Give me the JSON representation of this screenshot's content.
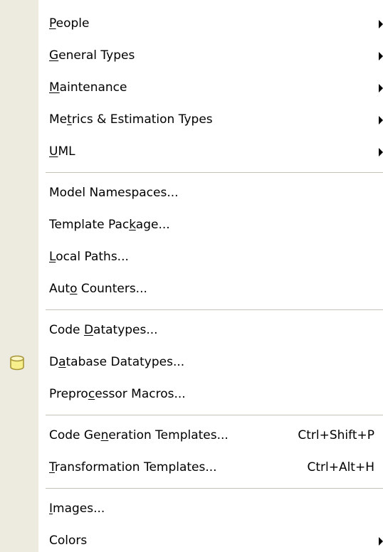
{
  "menu": {
    "people": {
      "label": "People",
      "mnemonic": "P"
    },
    "general_types": {
      "label": "General Types",
      "mnemonic": "G"
    },
    "maintenance": {
      "label": "Maintenance",
      "mnemonic": "M"
    },
    "metrics": {
      "label": "Metrics & Estimation Types",
      "mnemonic": "t"
    },
    "uml": {
      "label": "UML",
      "mnemonic": "U"
    },
    "model_namespaces": {
      "label": "Model Namespaces..."
    },
    "template_package": {
      "label": "Template Package...",
      "mnemonic": "k"
    },
    "local_paths": {
      "label": "Local Paths...",
      "mnemonic": "L"
    },
    "auto_counters": {
      "label": "Auto Counters...",
      "mnemonic": "o"
    },
    "code_datatypes": {
      "label": "Code Datatypes...",
      "mnemonic": "D"
    },
    "database_datatypes": {
      "label": "Database Datatypes...",
      "mnemonic": "a",
      "icon": "database-icon"
    },
    "preprocessor_macros": {
      "label": "Preprocessor Macros...",
      "mnemonic": "c"
    },
    "code_generation_templates": {
      "label": "Code Generation Templates...",
      "mnemonic": "n",
      "shortcut": "Ctrl+Shift+P"
    },
    "transformation_templates": {
      "label": "Transformation Templates...",
      "mnemonic": "T",
      "shortcut": "Ctrl+Alt+H"
    },
    "images": {
      "label": "Images...",
      "mnemonic": "I"
    },
    "colors": {
      "label": "Colors"
    }
  },
  "colors": {
    "gutter": "#edeadf",
    "separator": "#c5c2b8",
    "icon_fill": "#f7ee8c",
    "icon_stroke": "#a8973a"
  }
}
